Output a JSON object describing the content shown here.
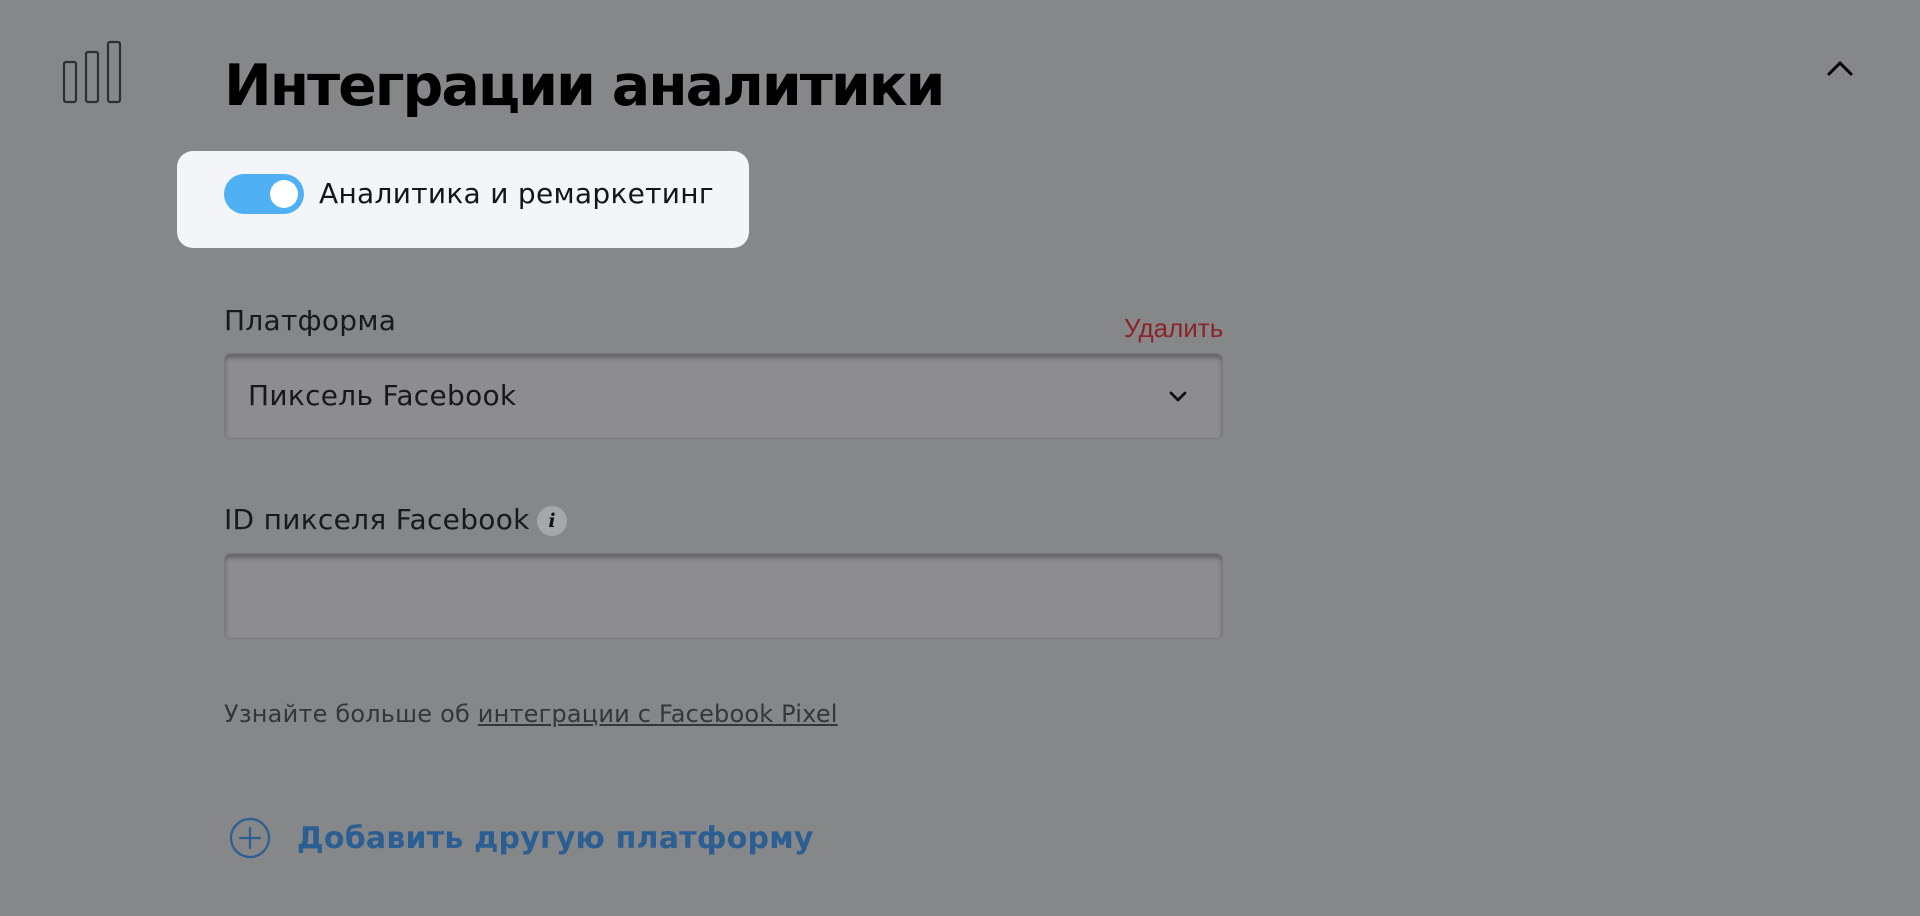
{
  "section": {
    "icon": "bar-chart-icon",
    "title": "Интеграции аналитики",
    "collapse_icon": "chevron-up-icon"
  },
  "toggle": {
    "label": "Аналитика и ремаркетинг",
    "checked": true,
    "accent_color": "#4fb0f4"
  },
  "platform": {
    "label": "Платформа",
    "delete_label": "Удалить",
    "delete_color": "#8b2328",
    "selected": "Пиксель Facebook",
    "dropdown_icon": "chevron-down-icon"
  },
  "pixel_id": {
    "label": "ID пикселя Facebook",
    "info_icon": "info-icon",
    "value": "",
    "placeholder": ""
  },
  "help": {
    "prefix": "Узнайте больше об ",
    "link_text": "интеграции с Facebook Pixel"
  },
  "add_platform": {
    "icon": "plus-circle-icon",
    "label": "Добавить другую платформу",
    "color": "#2b5e92"
  }
}
